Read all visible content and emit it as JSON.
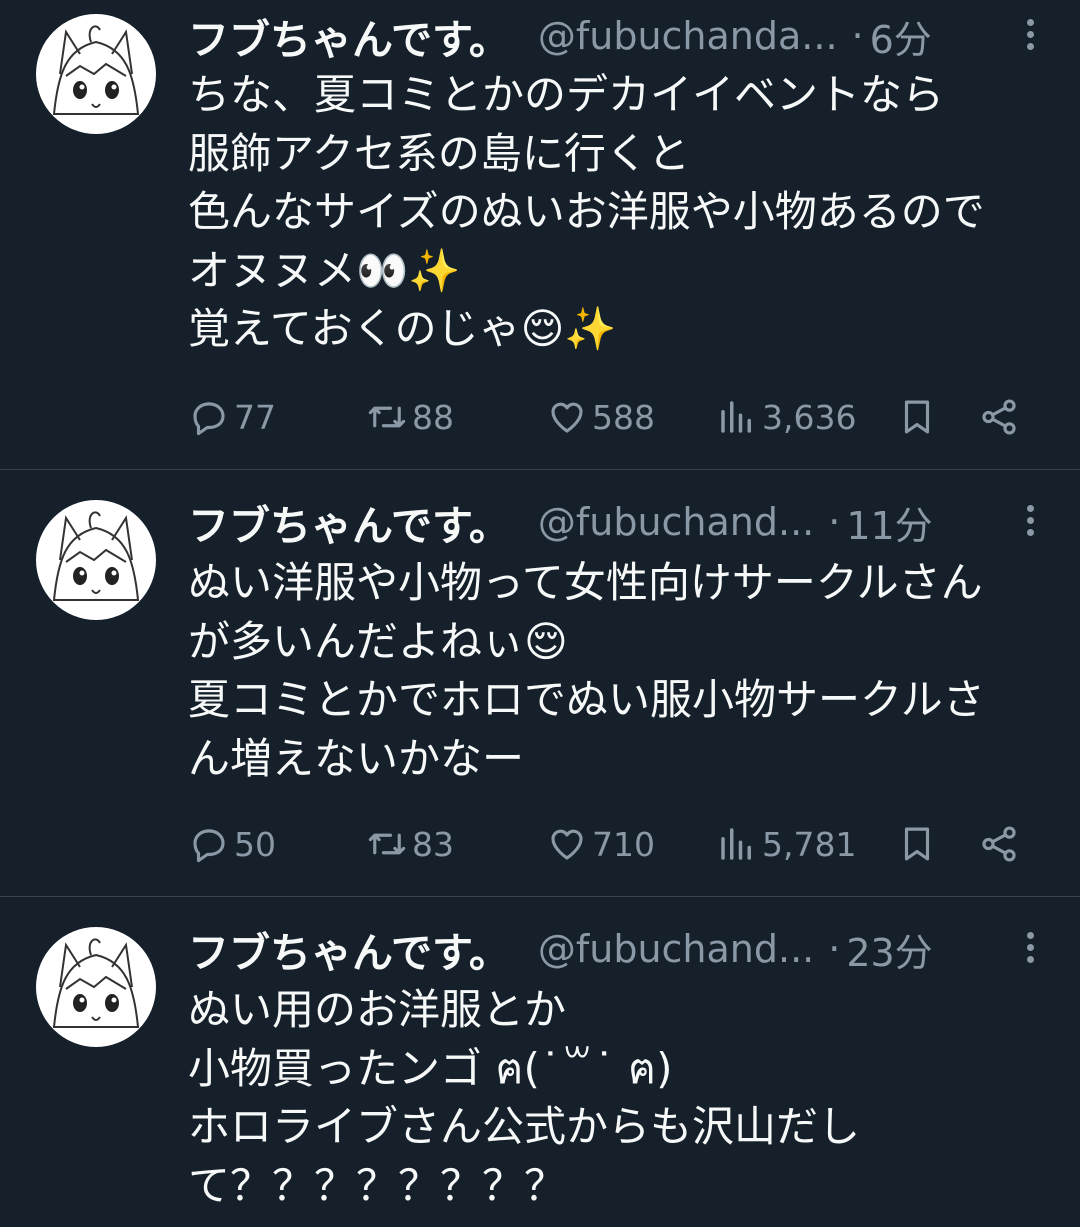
{
  "tweets": [
    {
      "author_name": "フブちゃんです。",
      "handle": "@fubuchanda...",
      "time": "6分",
      "text": "ちな、夏コミとかのデカイイベントなら\n服飾アクセ系の島に行くと\n色んなサイズのぬいお洋服や小物あるので\nオヌヌメ👀✨\n覚えておくのじゃ😌✨",
      "replies": "77",
      "retweets": "88",
      "likes": "588",
      "views": "3,636"
    },
    {
      "author_name": "フブちゃんです。",
      "handle": "@fubuchand...",
      "time": "11分",
      "text": "ぬい洋服や小物って女性向けサークルさん\nが多いんだよねぃ😌\n夏コミとかでホロでぬい服小物サークルさ\nん増えないかなー",
      "replies": "50",
      "retweets": "83",
      "likes": "710",
      "views": "5,781"
    },
    {
      "author_name": "フブちゃんです。",
      "handle": "@fubuchand...",
      "time": "23分",
      "text": "ぬい用のお洋服とか\n小物買ったンゴ ฅ(˙꒳˙ ฅ)\nホロライブさん公式からも沢山だし\nて？？？？？？？？"
    }
  ],
  "icons": {
    "reply": "reply-icon",
    "retweet": "retweet-icon",
    "like": "heart-icon",
    "views": "views-chart-icon",
    "bookmark": "bookmark-icon",
    "share": "share-icon",
    "more": "more-vertical-icon"
  },
  "colors": {
    "background": "#15202b",
    "text": "#f7f9f9",
    "secondary": "#8b98a5",
    "divider": "#38444d"
  }
}
